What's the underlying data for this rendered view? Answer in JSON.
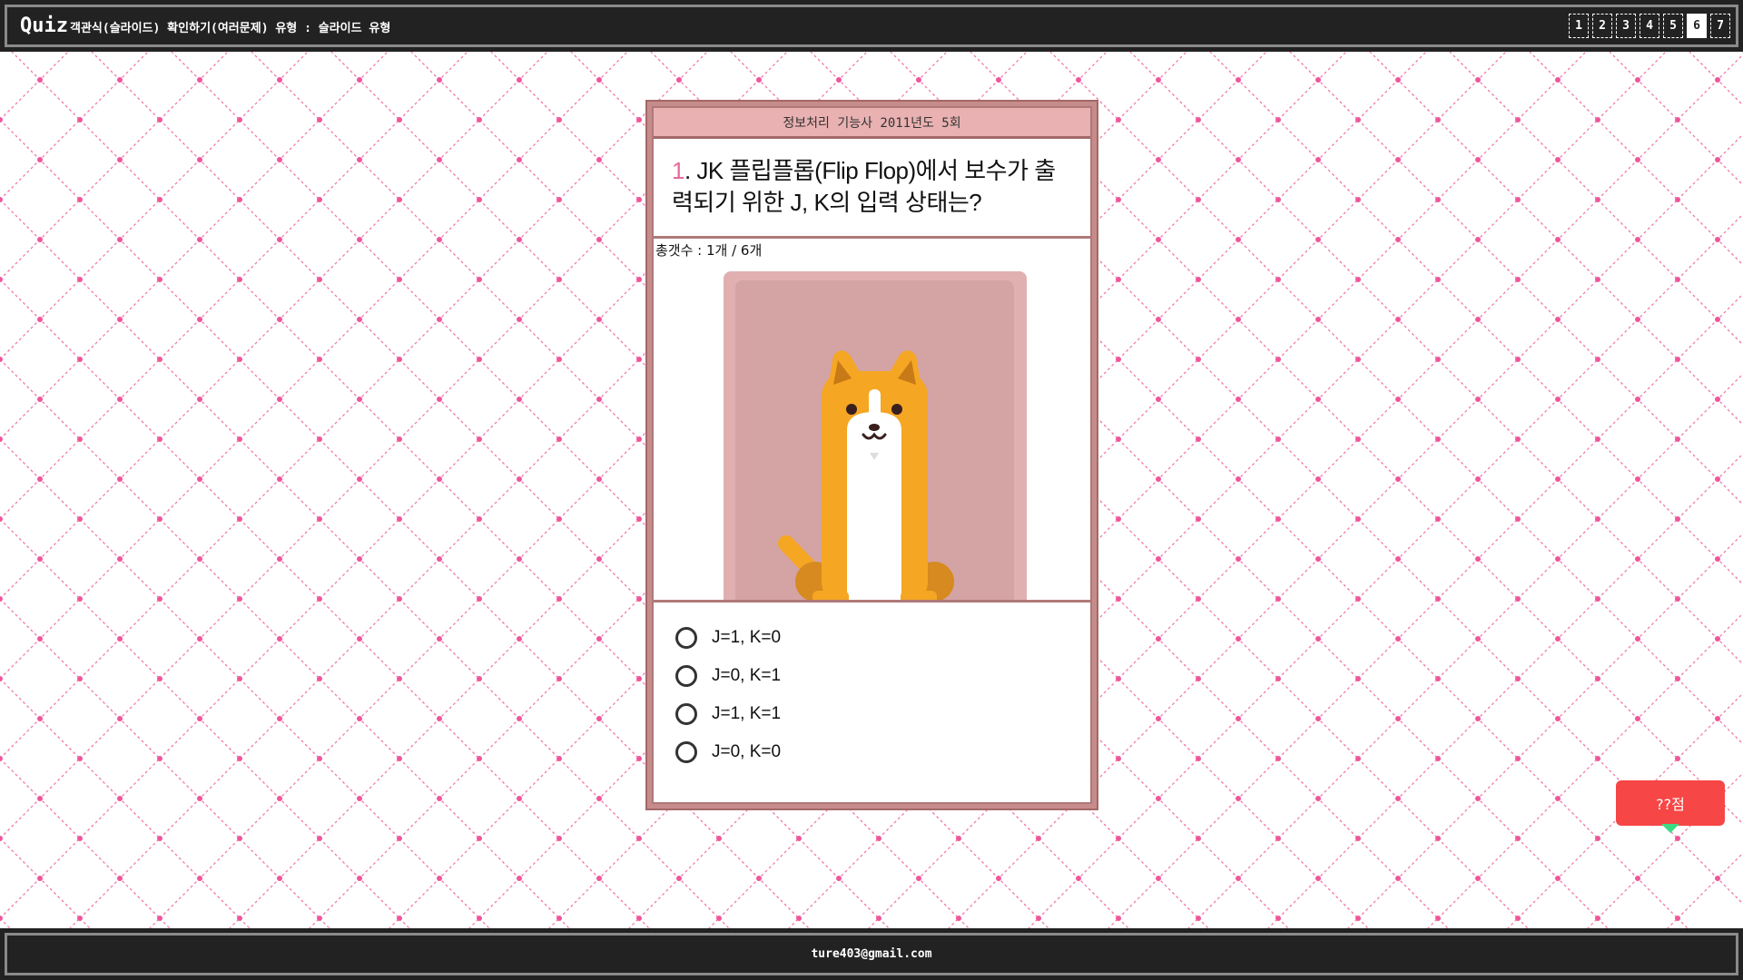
{
  "header": {
    "brand": "Quiz",
    "subtitle": "객관식(슬라이드) 확인하기(여러문제) 유형 : 슬라이드 유형",
    "pages": [
      {
        "label": "1",
        "active": false
      },
      {
        "label": "2",
        "active": false
      },
      {
        "label": "3",
        "active": false
      },
      {
        "label": "4",
        "active": false
      },
      {
        "label": "5",
        "active": false
      },
      {
        "label": "6",
        "active": true
      },
      {
        "label": "7",
        "active": false
      }
    ]
  },
  "card": {
    "exam_title": "정보처리 기능사 2011년도 5회",
    "question_number": "1",
    "question_text": ". JK 플립플롭(Flip Flop)에서 보수가 출력되기 위한 J, K의 입력 상태는?",
    "count_text": "총갯수 : 1개 / 6개",
    "choices": [
      {
        "label": "J=1, K=0"
      },
      {
        "label": "J=0, K=1"
      },
      {
        "label": "J=1, K=1"
      },
      {
        "label": "J=0, K=0"
      }
    ]
  },
  "score": {
    "label": "??점"
  },
  "footer": {
    "email": "ture403@gmail.com"
  },
  "colors": {
    "bar": "#222222",
    "card_frame": "#c68b8b",
    "card_header": "#e9b1b1",
    "accent_pink": "#e8699d",
    "score_bg": "#f74646",
    "pattern_dot": "#f0559a"
  },
  "icons": {
    "choice_radio": "radio-circle-icon",
    "illustration": "dog-illustration"
  }
}
